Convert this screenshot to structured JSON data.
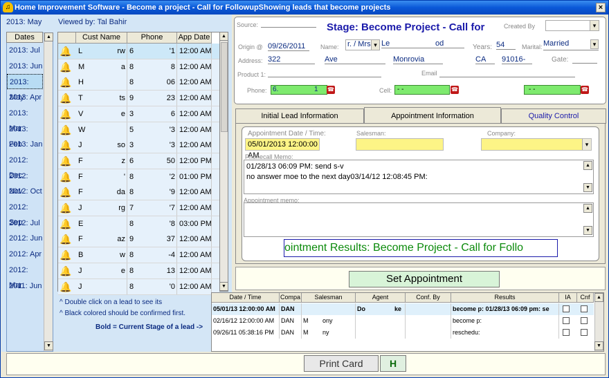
{
  "window": {
    "title": "Home Improvement Software - Become a project - Call for FollowupShowing leads that become projects",
    "close_glyph": "×"
  },
  "left": {
    "period": "2013: May",
    "viewed_by": "Viewed by: Tal Bahir",
    "dates_header": "Dates",
    "dates": [
      "2013: Jul",
      "2013: Jun",
      "2013: May",
      "2013: Apr",
      "2013: Mar",
      "2013: Feb",
      "2013: Jan",
      "2012: Dec",
      "2012: Nov",
      "2012: Oct",
      "2012: Sep",
      "2012: Jul",
      "2012: Jun",
      "2012: Apr",
      "2012: Mar",
      "2011: Jun"
    ],
    "selected_date_index": 2
  },
  "leads": {
    "columns": [
      "Cust Name",
      "Phone",
      "App Date"
    ],
    "rows": [
      {
        "name": "L",
        "name2": "rw",
        "phone": "6",
        "phone2": "'1",
        "time": "12:00 AM"
      },
      {
        "name": "M",
        "name2": "a",
        "phone": "8",
        "phone2": "8",
        "time": "12:00 AM"
      },
      {
        "name": "H",
        "name2": "",
        "phone": "8",
        "phone2": "06",
        "time": "12:00 AM"
      },
      {
        "name": "T",
        "name2": "ts",
        "phone": "9",
        "phone2": "23",
        "time": "12:00 AM"
      },
      {
        "name": "V",
        "name2": "e",
        "phone": "3",
        "phone2": "6",
        "time": "12:00 AM"
      },
      {
        "name": "W",
        "name2": "",
        "phone": "5",
        "phone2": "'3",
        "time": "12:00 AM"
      },
      {
        "name": "J",
        "name2": "so",
        "phone": "3",
        "phone2": "'3",
        "time": "12:00 AM"
      },
      {
        "name": "F",
        "name2": "z",
        "phone": "6",
        "phone2": "50",
        "time": "12:00 PM"
      },
      {
        "name": "F",
        "name2": "'",
        "phone": "8",
        "phone2": "'2",
        "time": "01:00 PM"
      },
      {
        "name": "F",
        "name2": "da",
        "phone": "8",
        "phone2": "'9",
        "time": "12:00 AM"
      },
      {
        "name": "J",
        "name2": "rg",
        "phone": "7",
        "phone2": "'7",
        "time": "12:00 AM"
      },
      {
        "name": "E",
        "name2": "",
        "phone": "8",
        "phone2": "'8",
        "time": "03:00 PM"
      },
      {
        "name": "F",
        "name2": "az",
        "phone": "9",
        "phone2": "37",
        "time": "12:00 AM"
      },
      {
        "name": "B",
        "name2": "w",
        "phone": "8",
        "phone2": "-4",
        "time": "12:00 AM"
      },
      {
        "name": "J",
        "name2": "e",
        "phone": "8",
        "phone2": "13",
        "time": "12:00 AM"
      },
      {
        "name": "J",
        "name2": "",
        "phone": "8",
        "phone2": "'0",
        "time": "12:00 AM"
      }
    ]
  },
  "hints": {
    "dbl": "^ Double click on a lead to see its",
    "black": "^ Black colored should be confirmed first.",
    "bold": "Bold = Current Stage of a lead  ->"
  },
  "lead_form": {
    "source_label": "Source:",
    "stage": "Stage: Become Project - Call for",
    "created_by_label": "Created By",
    "origin_label": "Origin @",
    "origin": "09/26/2011",
    "name_label": "Name:",
    "title": "r. / Mrs.",
    "first": "Le",
    "last": "od",
    "years_label": "Years:",
    "years": "54",
    "marital_label": "Marital:",
    "marital": "Married",
    "address_label": "Address:",
    "addr_num": "322",
    "addr_street": "Ave",
    "city": "Monrovia",
    "state": "CA",
    "zip": "91016-",
    "gate_label": "Gate:",
    "product_label": "Product 1:",
    "email_label": "Email",
    "phone_label": "Phone:",
    "phone": "6.",
    "phone_mid": "1",
    "cell_label": "Cell:",
    "cell": "-  -",
    "other_phone": "-  -",
    "dropdown_glyph": "▾",
    "phone_glyph": "☎"
  },
  "tabs": [
    "Initial Lead Information",
    "Appointment Information",
    "Quality Control"
  ],
  "active_tab": 1,
  "appointment": {
    "date_label": "Appointment Date / Time:",
    "date": "05/01/2013 12:00:00 AM",
    "salesman_label": "Salesman:",
    "company_label": "Company:",
    "phonecall_label": "Phonecall Memo:",
    "memo_line1": "01/28/13 06:09 PM: send s-v",
    "memo_line2": "no answer moe to the next day03/14/12 12:08:45 PM:",
    "appt_memo_label": "Appointment memo:",
    "results": "ointment Results: Become Project - Call for Follo",
    "set_button": "Set Appointment"
  },
  "history": {
    "columns": [
      "Date / Time",
      "Compa",
      "Salesman",
      "Agent",
      "Conf. By",
      "Results",
      "IA",
      "Cnf"
    ],
    "rows": [
      {
        "date": "05/01/13 12:00:00 AM",
        "company": "DAN",
        "salesman": "",
        "agent": "Do",
        "agent2": "ke",
        "conf": "",
        "results": "become p: 01/28/13 06:09 pm: se",
        "bold": true
      },
      {
        "date": "02/16/12 12:00:00 AM",
        "company": "DAN",
        "salesman": "M",
        "salesman2": "ony",
        "agent": "",
        "conf": "",
        "results": "become p:",
        "bold": false
      },
      {
        "date": "09/26/11 05:38:16 PM",
        "company": "DAN",
        "salesman": "M",
        "salesman2": "ny",
        "agent": "",
        "conf": "",
        "results": "reschedu:",
        "bold": false
      }
    ]
  },
  "bottom": {
    "print": "Print Card",
    "h": "H"
  },
  "scroll": {
    "up": "▲",
    "down": "▼"
  },
  "colors": {
    "accent": "#0a2a80",
    "stage": "#1a1aaa",
    "results": "#0a8a0a",
    "highlight_green": "#7eea6e",
    "highlight_yellow": "#fdf486"
  }
}
